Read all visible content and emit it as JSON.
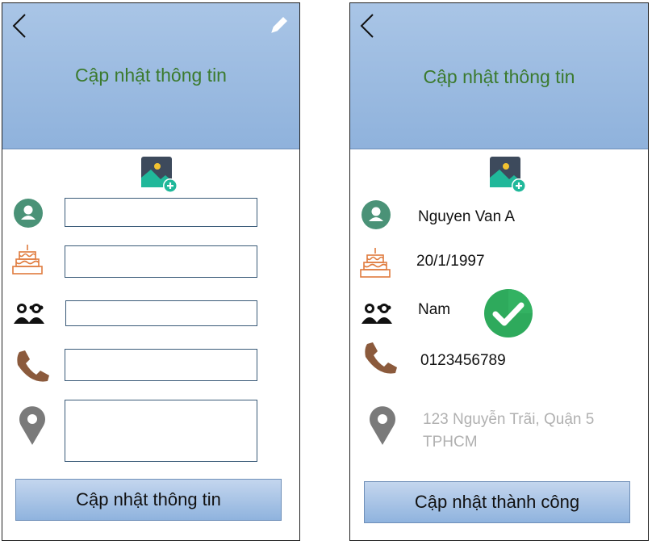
{
  "left_screen": {
    "title": "Cập nhật thông tin",
    "submit_label": "Cập nhật thông tin",
    "fields": {
      "name": "",
      "birthday": "",
      "gender": "",
      "phone": "",
      "address": ""
    }
  },
  "right_screen": {
    "title": "Cập nhật thông tin",
    "name": "Nguyen Van A",
    "birthday": "20/1/1997",
    "gender": "Nam",
    "phone": "0123456789",
    "address": "123 Nguyễn  Trãi, Quận 5 TPHCM",
    "status_label": "Cập nhật thành công"
  },
  "icons": [
    "back-icon",
    "edit-icon",
    "add-photo-icon",
    "user-icon",
    "birthday-cake-icon",
    "gender-icon",
    "phone-icon",
    "location-pin-icon",
    "success-check-icon"
  ],
  "colors": {
    "header": "#9fbde2",
    "title": "#3b7a2e",
    "check": "#27ae60"
  }
}
